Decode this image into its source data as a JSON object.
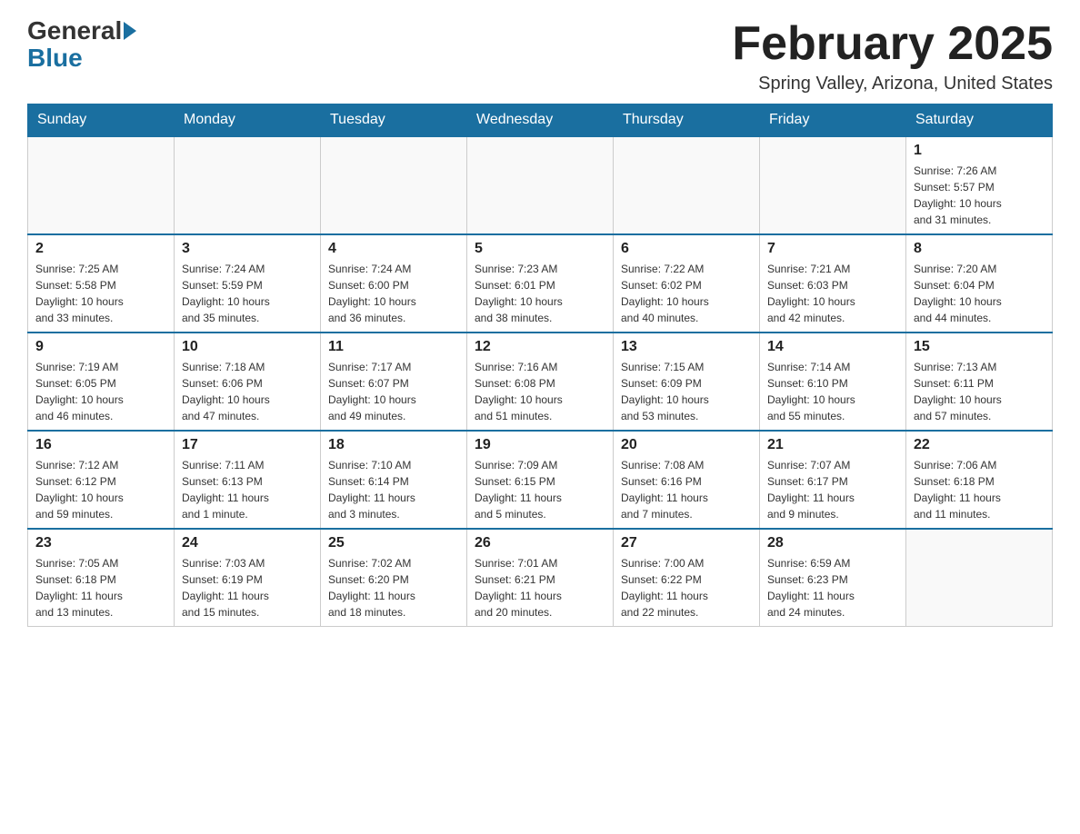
{
  "header": {
    "logo_general": "General",
    "logo_blue": "Blue",
    "month_title": "February 2025",
    "location": "Spring Valley, Arizona, United States"
  },
  "weekdays": [
    "Sunday",
    "Monday",
    "Tuesday",
    "Wednesday",
    "Thursday",
    "Friday",
    "Saturday"
  ],
  "weeks": [
    [
      {
        "day": "",
        "info": ""
      },
      {
        "day": "",
        "info": ""
      },
      {
        "day": "",
        "info": ""
      },
      {
        "day": "",
        "info": ""
      },
      {
        "day": "",
        "info": ""
      },
      {
        "day": "",
        "info": ""
      },
      {
        "day": "1",
        "info": "Sunrise: 7:26 AM\nSunset: 5:57 PM\nDaylight: 10 hours\nand 31 minutes."
      }
    ],
    [
      {
        "day": "2",
        "info": "Sunrise: 7:25 AM\nSunset: 5:58 PM\nDaylight: 10 hours\nand 33 minutes."
      },
      {
        "day": "3",
        "info": "Sunrise: 7:24 AM\nSunset: 5:59 PM\nDaylight: 10 hours\nand 35 minutes."
      },
      {
        "day": "4",
        "info": "Sunrise: 7:24 AM\nSunset: 6:00 PM\nDaylight: 10 hours\nand 36 minutes."
      },
      {
        "day": "5",
        "info": "Sunrise: 7:23 AM\nSunset: 6:01 PM\nDaylight: 10 hours\nand 38 minutes."
      },
      {
        "day": "6",
        "info": "Sunrise: 7:22 AM\nSunset: 6:02 PM\nDaylight: 10 hours\nand 40 minutes."
      },
      {
        "day": "7",
        "info": "Sunrise: 7:21 AM\nSunset: 6:03 PM\nDaylight: 10 hours\nand 42 minutes."
      },
      {
        "day": "8",
        "info": "Sunrise: 7:20 AM\nSunset: 6:04 PM\nDaylight: 10 hours\nand 44 minutes."
      }
    ],
    [
      {
        "day": "9",
        "info": "Sunrise: 7:19 AM\nSunset: 6:05 PM\nDaylight: 10 hours\nand 46 minutes."
      },
      {
        "day": "10",
        "info": "Sunrise: 7:18 AM\nSunset: 6:06 PM\nDaylight: 10 hours\nand 47 minutes."
      },
      {
        "day": "11",
        "info": "Sunrise: 7:17 AM\nSunset: 6:07 PM\nDaylight: 10 hours\nand 49 minutes."
      },
      {
        "day": "12",
        "info": "Sunrise: 7:16 AM\nSunset: 6:08 PM\nDaylight: 10 hours\nand 51 minutes."
      },
      {
        "day": "13",
        "info": "Sunrise: 7:15 AM\nSunset: 6:09 PM\nDaylight: 10 hours\nand 53 minutes."
      },
      {
        "day": "14",
        "info": "Sunrise: 7:14 AM\nSunset: 6:10 PM\nDaylight: 10 hours\nand 55 minutes."
      },
      {
        "day": "15",
        "info": "Sunrise: 7:13 AM\nSunset: 6:11 PM\nDaylight: 10 hours\nand 57 minutes."
      }
    ],
    [
      {
        "day": "16",
        "info": "Sunrise: 7:12 AM\nSunset: 6:12 PM\nDaylight: 10 hours\nand 59 minutes."
      },
      {
        "day": "17",
        "info": "Sunrise: 7:11 AM\nSunset: 6:13 PM\nDaylight: 11 hours\nand 1 minute."
      },
      {
        "day": "18",
        "info": "Sunrise: 7:10 AM\nSunset: 6:14 PM\nDaylight: 11 hours\nand 3 minutes."
      },
      {
        "day": "19",
        "info": "Sunrise: 7:09 AM\nSunset: 6:15 PM\nDaylight: 11 hours\nand 5 minutes."
      },
      {
        "day": "20",
        "info": "Sunrise: 7:08 AM\nSunset: 6:16 PM\nDaylight: 11 hours\nand 7 minutes."
      },
      {
        "day": "21",
        "info": "Sunrise: 7:07 AM\nSunset: 6:17 PM\nDaylight: 11 hours\nand 9 minutes."
      },
      {
        "day": "22",
        "info": "Sunrise: 7:06 AM\nSunset: 6:18 PM\nDaylight: 11 hours\nand 11 minutes."
      }
    ],
    [
      {
        "day": "23",
        "info": "Sunrise: 7:05 AM\nSunset: 6:18 PM\nDaylight: 11 hours\nand 13 minutes."
      },
      {
        "day": "24",
        "info": "Sunrise: 7:03 AM\nSunset: 6:19 PM\nDaylight: 11 hours\nand 15 minutes."
      },
      {
        "day": "25",
        "info": "Sunrise: 7:02 AM\nSunset: 6:20 PM\nDaylight: 11 hours\nand 18 minutes."
      },
      {
        "day": "26",
        "info": "Sunrise: 7:01 AM\nSunset: 6:21 PM\nDaylight: 11 hours\nand 20 minutes."
      },
      {
        "day": "27",
        "info": "Sunrise: 7:00 AM\nSunset: 6:22 PM\nDaylight: 11 hours\nand 22 minutes."
      },
      {
        "day": "28",
        "info": "Sunrise: 6:59 AM\nSunset: 6:23 PM\nDaylight: 11 hours\nand 24 minutes."
      },
      {
        "day": "",
        "info": ""
      }
    ]
  ]
}
